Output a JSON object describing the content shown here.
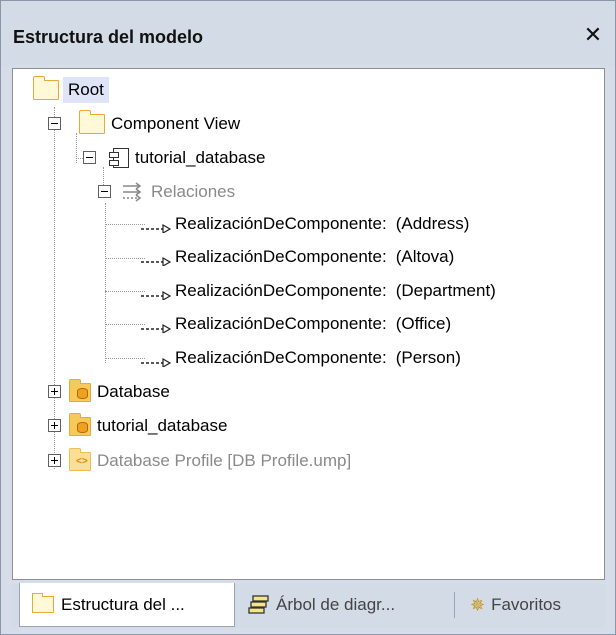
{
  "window": {
    "title": "Estructura del modelo",
    "close_glyph": "✕"
  },
  "tree": {
    "root": "Root",
    "component_view": "Component View",
    "tutorial_database": "tutorial_database",
    "relaciones": "Relaciones",
    "realizations": [
      {
        "label": "RealizaciónDeComponente:",
        "target": "(Address)"
      },
      {
        "label": "RealizaciónDeComponente:",
        "target": "(Altova)"
      },
      {
        "label": "RealizaciónDeComponente:",
        "target": "(Department)"
      },
      {
        "label": "RealizaciónDeComponente:",
        "target": "(Office)"
      },
      {
        "label": "RealizaciónDeComponente:",
        "target": "(Person)"
      }
    ],
    "database": "Database",
    "tutorial_database_pkg": "tutorial_database",
    "database_profile": "Database Profile [DB Profile.ump]"
  },
  "tabs": [
    {
      "label": "Estructura del ...",
      "icon": "folder-icon",
      "active": true
    },
    {
      "label": "Árbol de diagr...",
      "icon": "diagram-tree-icon",
      "active": false
    },
    {
      "label": "Favoritos",
      "icon": "favorites-icon",
      "active": false
    }
  ],
  "colors": {
    "title_bar": "#d3dbe7",
    "root_highlight": "#dfe4f7",
    "folder_border": "#e8a93a",
    "disabled_text": "#8a8a8a"
  }
}
